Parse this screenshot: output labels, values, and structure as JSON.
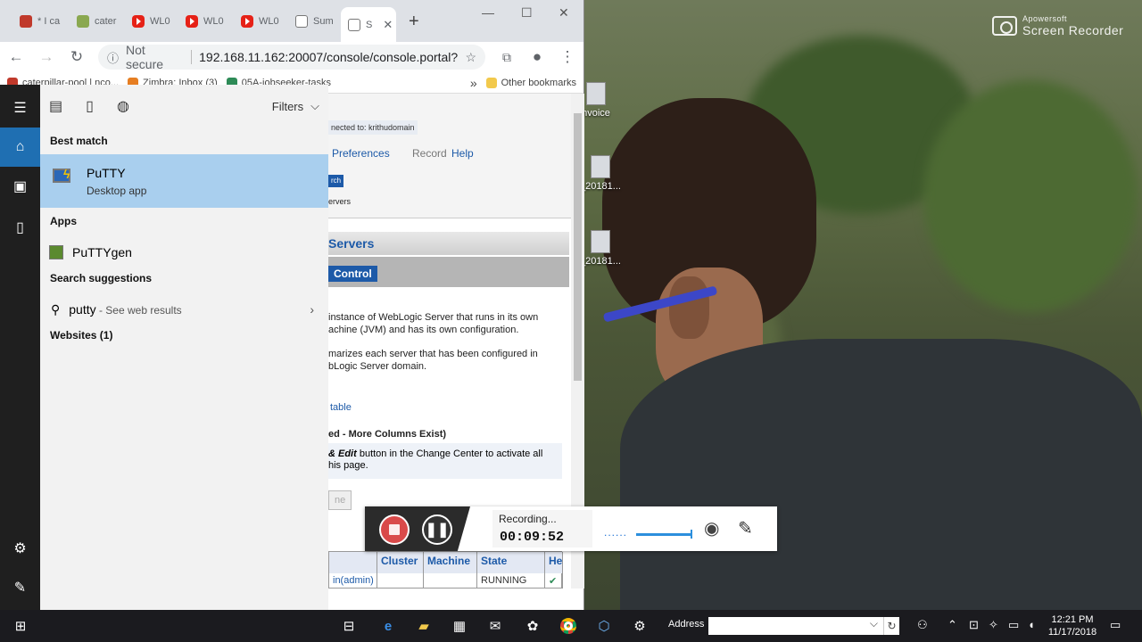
{
  "browser": {
    "tabs": [
      {
        "label": "* I ca",
        "icon": "flag-icon",
        "color": "#c0392b"
      },
      {
        "label": "cater",
        "icon": "caterpillar-icon",
        "color": "#7a9a3a"
      },
      {
        "label": "WL0",
        "icon": "youtube-icon",
        "color": "#e62117"
      },
      {
        "label": "WL0",
        "icon": "youtube-icon",
        "color": "#e62117"
      },
      {
        "label": "WL0",
        "icon": "youtube-icon",
        "color": "#e62117"
      },
      {
        "label": "Sum",
        "icon": "page-icon",
        "color": "#888888"
      },
      {
        "label": "S",
        "icon": "page-icon",
        "color": "#888888"
      }
    ],
    "new_tab": "+",
    "window_controls": {
      "minimize": "—",
      "maximize": "☐",
      "close": "✕"
    },
    "security_label": "Not secure",
    "url": "192.168.11.162:20007/console/console.portal?...",
    "bookmarks": [
      {
        "label": "caterpillar-pool | nco...",
        "color": "#c0392b"
      },
      {
        "label": "Zimbra: Inbox (3)",
        "color": "#e67e22"
      },
      {
        "label": "05A-jobseeker-tasks",
        "color": "#2e8b57"
      }
    ],
    "bookmarks_overflow": "»",
    "other_bookmarks": "Other bookmarks"
  },
  "weblogic": {
    "connected": "nected to: krithudomain",
    "links": [
      "Preferences",
      "Record",
      "Help"
    ],
    "search_button": "rch",
    "servers_crumb": "ervers",
    "section_title": "Servers",
    "tab": "Control",
    "para1": [
      "instance of WebLogic Server that runs in its own",
      "achine (JVM) and has its own configuration."
    ],
    "para2": [
      "marizes each server that has been configured in",
      "bLogic Server domain."
    ],
    "table_link": "table",
    "table_heading": "ed - More Columns Exist)",
    "note_edit": "& Edit",
    "note_rest": " button in the Change Center to activate all",
    "note_line2": "his page.",
    "faded_button": "ne",
    "columns": [
      "",
      "Cluster",
      "Machine",
      "State",
      "He"
    ],
    "row": [
      "in(admin)",
      "",
      "",
      "RUNNING",
      ""
    ]
  },
  "desktop": {
    "icons": [
      "nvoice",
      "_20181...",
      "_20181..."
    ],
    "recorder_brand_small": "Apowersoft",
    "recorder_brand_big": "Screen Recorder"
  },
  "start_menu": {
    "filters_label": "Filters",
    "best_match_heading": "Best match",
    "best_match": {
      "name": "PuTTY",
      "sub": "Desktop app"
    },
    "apps_heading": "Apps",
    "apps": [
      {
        "bold": "PuTTY",
        "rest": "gen"
      }
    ],
    "search_suggestions_heading": "Search suggestions",
    "suggestion": {
      "query": "putty",
      "hint": " - See web results"
    },
    "websites_heading": "Websites (1)",
    "search_text": "putty",
    "accent": "#a9cfee"
  },
  "recorder": {
    "status": "Recording...",
    "elapsed": "00:09:52",
    "dots": "......",
    "volume_level": 1.0
  },
  "taskbar": {
    "address_label": "Address",
    "time": "12:21 PM",
    "date": "11/17/2018"
  }
}
